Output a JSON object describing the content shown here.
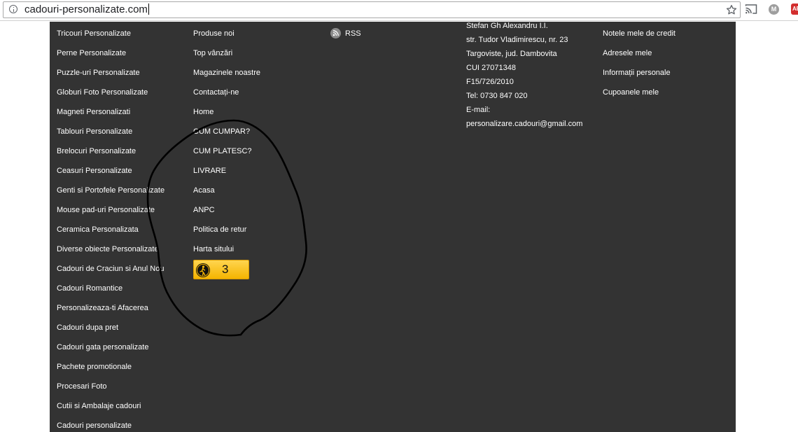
{
  "browser": {
    "url": "cadouri-personalizate.com",
    "icons": [
      "info-icon",
      "star-icon",
      "cast-icon",
      "extension-m-icon",
      "adblock-icon"
    ],
    "ext_m_label": "M",
    "adblock_label": "AB"
  },
  "footer": {
    "categories": [
      "Tricouri Personalizate",
      "Perne Personalizate",
      "Puzzle-uri Personalizate",
      "Globuri Foto Personalizate",
      "Magneti Personalizati",
      "Tablouri Personalizate",
      "Brelocuri Personalizate",
      "Ceasuri Personalizate",
      "Genti si Portofele Personalizate",
      "Mouse pad-uri Personalizate",
      "Ceramica Personalizata",
      "Diverse obiecte Personalizate",
      "Cadouri de Craciun si Anul Nou",
      "Cadouri Romantice",
      "Personalizeaza-ti Afacerea",
      "Cadouri dupa pret",
      "Cadouri gata personalizate",
      "Pachete promotionale",
      "Procesari Foto",
      "Cutii si Ambalaje cadouri",
      "Cadouri personalizate"
    ],
    "info_links": [
      "Produse noi",
      "Top vânzări",
      "Magazinele noastre",
      "Contactați-ne",
      "Home",
      "CUM CUMPAR?",
      "CUM PLATESC?",
      "LIVRARE",
      "Acasa",
      "ANPC",
      "Politica de retur",
      "Harta sitului"
    ],
    "badge": {
      "count": "3",
      "icon": "hiker-icon"
    },
    "rss_label": "RSS",
    "contact_lines": [
      "Stefan Gh Alexandru I.I.",
      "str. Tudor Vladimirescu, nr. 23",
      "Targoviste, jud. Dambovita",
      "CUI 27071348",
      "F15/726/2010",
      "Tel: 0730 847 020",
      "E-mail:",
      "personalizare.cadouri@gmail.com"
    ],
    "account_links": [
      "Notele mele de credit",
      "Adresele mele",
      "Informații personale",
      "Cupoanele mele"
    ]
  },
  "colors": {
    "footer_bg": "#333333",
    "footer_text": "#ffffff",
    "badge_yellow": "#f5b400",
    "annotation_stroke": "#000000"
  }
}
